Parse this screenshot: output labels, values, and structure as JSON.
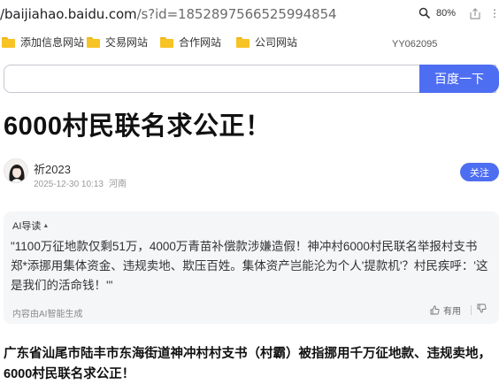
{
  "browser": {
    "url_host": "/baijiahao.baidu.com",
    "url_path": "/s?id=1852897566525994854",
    "zoom": "80%"
  },
  "bookmarks": {
    "items": [
      {
        "label": "添加信息网站"
      },
      {
        "label": "交易网站"
      },
      {
        "label": "合作网站"
      },
      {
        "label": "公司网站"
      }
    ],
    "user": "YY062095"
  },
  "search": {
    "value": "",
    "button_label": "百度一下"
  },
  "article": {
    "title": "6000村民联名求公正！",
    "author": "祈2023",
    "date": "2025-12-30 10:13",
    "location": "河南",
    "follow_label": "关注",
    "body": "广东省汕尾市陆丰市东海街道神冲村村支书（村霸）被指挪用千万征地款、违规卖地，6000村民联名求公正！"
  },
  "ai_summary": {
    "label": "AI导读",
    "text": "\"1100万征地款仅剩51万，4000万青苗补偿款涉嫌造假！神冲村6000村民联名举报村支书郑*添挪用集体资金、违规卖地、欺压百姓。集体资产岂能沦为个人'提款机'？村民疾呼：'这是我们的活命钱！'\"",
    "footer": "内容由AI智能生成",
    "useful_label": "有用"
  },
  "colors": {
    "accent": "#4e6ef2",
    "folder": "#f7c325"
  }
}
